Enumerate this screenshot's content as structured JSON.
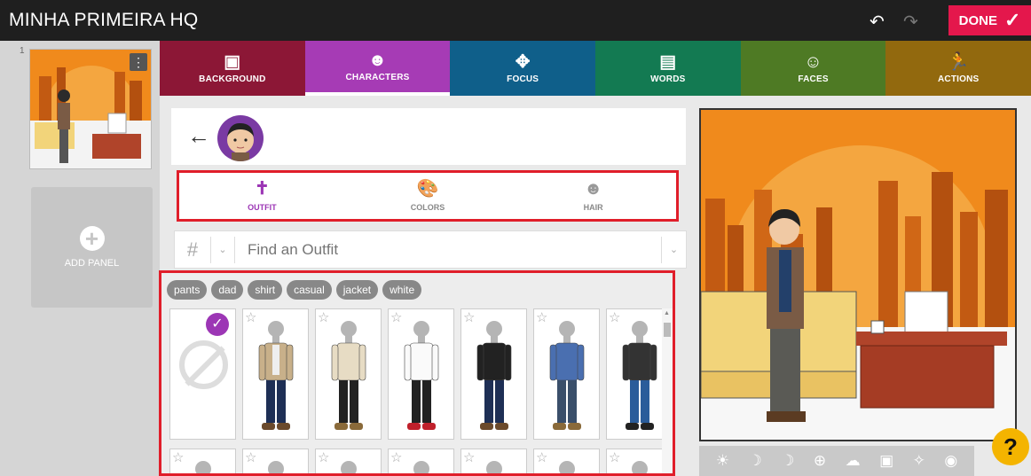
{
  "app": {
    "title": "MINHA PRIMEIRA HQ",
    "done_label": "DONE",
    "undo_icon": "↶",
    "redo_icon": "↷"
  },
  "panels": {
    "number": "1",
    "menu_icon": "⋮",
    "add_label": "ADD PANEL"
  },
  "tabs": [
    {
      "label": "BACKGROUND",
      "icon": "▣",
      "color": "#8c1736"
    },
    {
      "label": "CHARACTERS",
      "icon": "☻",
      "color": "#a63bb5"
    },
    {
      "label": "FOCUS",
      "icon": "✥",
      "color": "#0f5f8a"
    },
    {
      "label": "WORDS",
      "icon": "▤",
      "color": "#137a52"
    },
    {
      "label": "FACES",
      "icon": "☺",
      "color": "#4e7a24"
    },
    {
      "label": "ACTIONS",
      "icon": "🏃",
      "color": "#92690e"
    }
  ],
  "editor": {
    "back_icon": "←",
    "subtabs": [
      {
        "label": "OUTFIT",
        "icon": "✝"
      },
      {
        "label": "COLORS",
        "icon": "🎨"
      },
      {
        "label": "HAIR",
        "icon": "☻"
      }
    ],
    "search": {
      "hash": "#",
      "placeholder": "Find an Outfit",
      "chevron": "⌄"
    },
    "tags": [
      "pants",
      "dad",
      "shirt",
      "casual",
      "jacket",
      "white"
    ],
    "outfits": [
      {
        "jacket": "#c8b08a",
        "shirt": "#eee",
        "pants": "#1e2f55",
        "shoes": "#6b4a2c"
      },
      {
        "jacket": "#e7dcc4",
        "shirt": "#e7dcc4",
        "pants": "#222",
        "shoes": "#8a6a3a"
      },
      {
        "jacket": "#fafafa",
        "shirt": "#fafafa",
        "pants": "#222",
        "shoes": "#c0202b"
      },
      {
        "jacket": "#222",
        "shirt": "#222",
        "pants": "#1e2f55",
        "shoes": "#6b4a2c"
      },
      {
        "jacket": "#4a6fb0",
        "shirt": "#4a6fb0",
        "pants": "#3a4f6a",
        "shoes": "#8a6a3a"
      },
      {
        "jacket": "#333",
        "shirt": "#333",
        "pants": "#2a5c9a",
        "shoes": "#222"
      }
    ]
  },
  "preview_toolbar": [
    "☀",
    "☽",
    "☽",
    "⊕",
    "☁",
    "▣",
    "✧",
    "◉"
  ],
  "help": {
    "label": "?"
  }
}
